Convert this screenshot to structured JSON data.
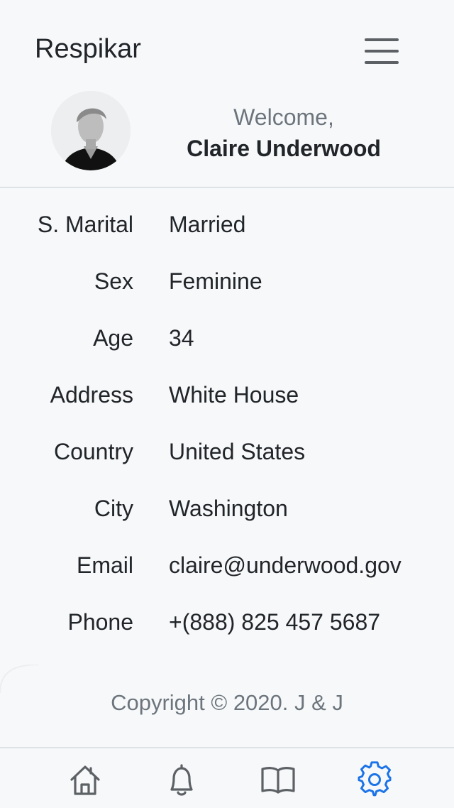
{
  "header": {
    "app_title": "Respikar"
  },
  "profile": {
    "welcome": "Welcome,",
    "name": "Claire Underwood"
  },
  "details": [
    {
      "label": "S. Marital",
      "value": "Married"
    },
    {
      "label": "Sex",
      "value": "Feminine"
    },
    {
      "label": "Age",
      "value": "34"
    },
    {
      "label": "Address",
      "value": "White House"
    },
    {
      "label": "Country",
      "value": "United States"
    },
    {
      "label": "City",
      "value": "Washington"
    },
    {
      "label": "Email",
      "value": "claire@underwood.gov"
    },
    {
      "label": "Phone",
      "value": "+(888) 825 457 5687"
    }
  ],
  "footer": {
    "copyright": "Copyright © 2020. J & J"
  },
  "nav": {
    "items": [
      {
        "icon": "home-icon",
        "active": false
      },
      {
        "icon": "bell-icon",
        "active": false
      },
      {
        "icon": "book-icon",
        "active": false
      },
      {
        "icon": "gear-icon",
        "active": true
      }
    ]
  },
  "colors": {
    "accent": "#1a73e8",
    "icon": "#5d6165",
    "text": "#212529",
    "muted": "#6c757d"
  }
}
